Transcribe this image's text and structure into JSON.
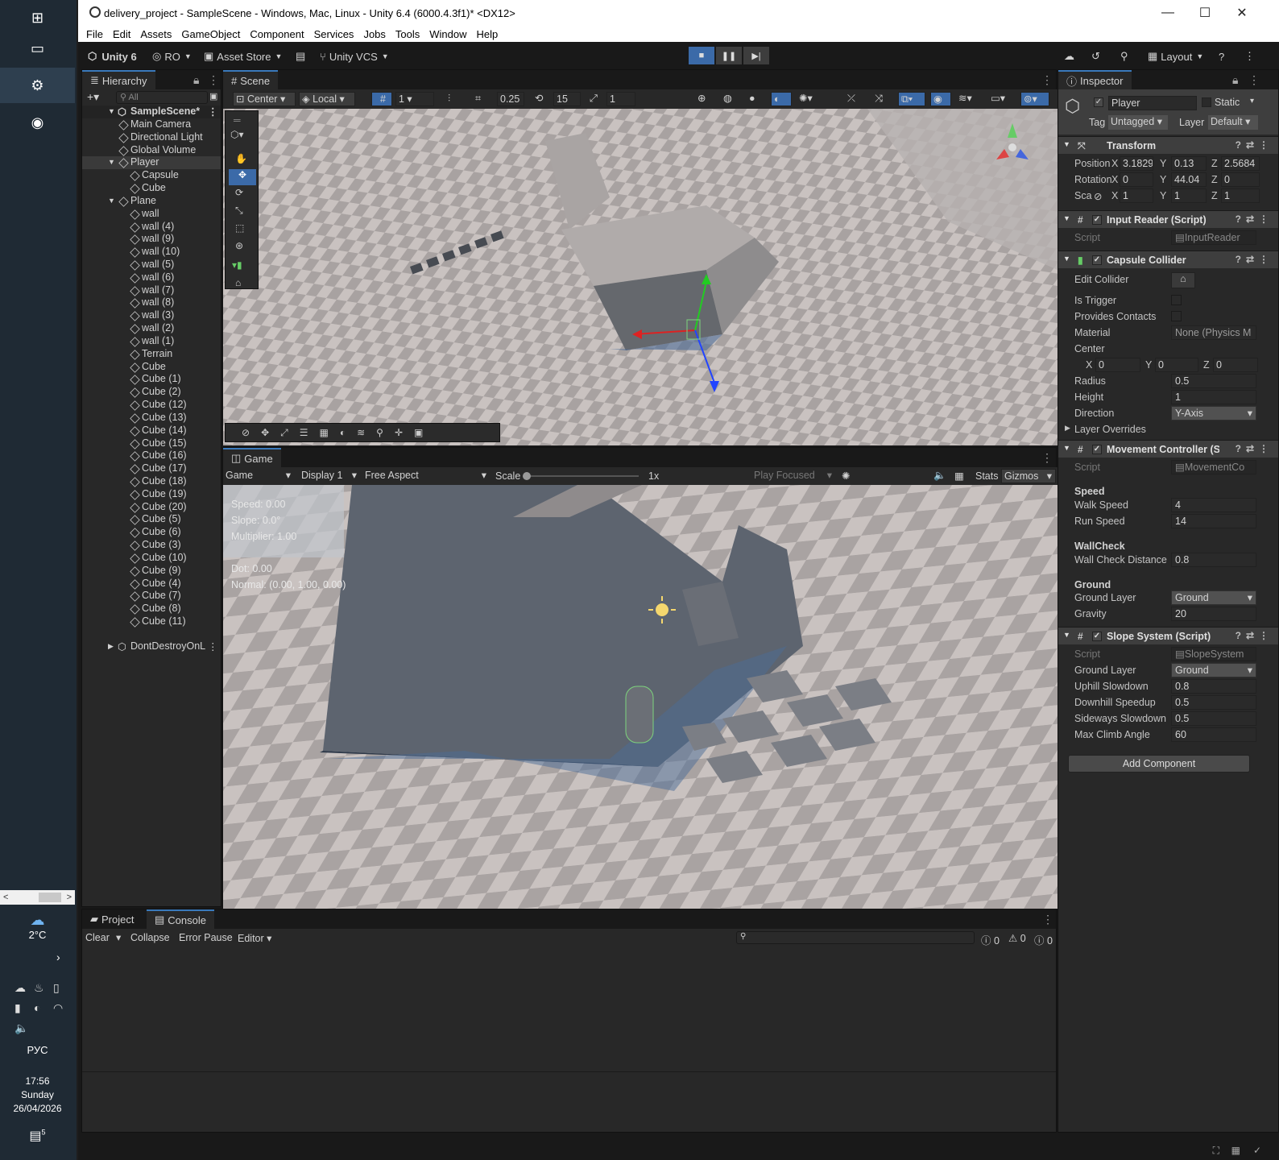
{
  "window": {
    "title": "delivery_project - SampleScene - Windows, Mac, Linux - Unity 6.4 (6000.4.3f1)* <DX12>",
    "controls": [
      "—",
      "☐",
      "✕"
    ]
  },
  "menu": [
    "File",
    "Edit",
    "Assets",
    "GameObject",
    "Component",
    "Services",
    "Jobs",
    "Tools",
    "Window",
    "Help"
  ],
  "toolbar": {
    "unity_label": "Unity 6",
    "account": "RO",
    "asset_store": "Asset Store",
    "vcs": "Unity VCS",
    "layout": "Layout"
  },
  "hierarchy": {
    "tab": "Hierarchy",
    "search_placeholder": "All",
    "scene": "SampleScene*",
    "items": [
      {
        "label": "Main Camera",
        "depth": 1
      },
      {
        "label": "Directional Light",
        "depth": 1
      },
      {
        "label": "Global Volume",
        "depth": 1
      },
      {
        "label": "Player",
        "depth": 1,
        "expand": true,
        "selected": true
      },
      {
        "label": "Capsule",
        "depth": 2
      },
      {
        "label": "Cube",
        "depth": 2
      },
      {
        "label": "Plane",
        "depth": 1,
        "expand": true
      },
      {
        "label": "wall",
        "depth": 2
      },
      {
        "label": "wall (4)",
        "depth": 2
      },
      {
        "label": "wall (9)",
        "depth": 2
      },
      {
        "label": "wall (10)",
        "depth": 2
      },
      {
        "label": "wall (5)",
        "depth": 2
      },
      {
        "label": "wall (6)",
        "depth": 2
      },
      {
        "label": "wall (7)",
        "depth": 2
      },
      {
        "label": "wall (8)",
        "depth": 2
      },
      {
        "label": "wall (3)",
        "depth": 2
      },
      {
        "label": "wall (2)",
        "depth": 2
      },
      {
        "label": "wall (1)",
        "depth": 2
      },
      {
        "label": "Terrain",
        "depth": 2
      },
      {
        "label": "Cube",
        "depth": 2
      },
      {
        "label": "Cube (1)",
        "depth": 2
      },
      {
        "label": "Cube (2)",
        "depth": 2
      },
      {
        "label": "Cube (12)",
        "depth": 2
      },
      {
        "label": "Cube (13)",
        "depth": 2
      },
      {
        "label": "Cube (14)",
        "depth": 2
      },
      {
        "label": "Cube (15)",
        "depth": 2
      },
      {
        "label": "Cube (16)",
        "depth": 2
      },
      {
        "label": "Cube (17)",
        "depth": 2
      },
      {
        "label": "Cube (18)",
        "depth": 2
      },
      {
        "label": "Cube (19)",
        "depth": 2
      },
      {
        "label": "Cube (20)",
        "depth": 2
      },
      {
        "label": "Cube (5)",
        "depth": 2
      },
      {
        "label": "Cube (6)",
        "depth": 2
      },
      {
        "label": "Cube (3)",
        "depth": 2
      },
      {
        "label": "Cube (10)",
        "depth": 2
      },
      {
        "label": "Cube (9)",
        "depth": 2
      },
      {
        "label": "Cube (4)",
        "depth": 2
      },
      {
        "label": "Cube (7)",
        "depth": 2
      },
      {
        "label": "Cube (8)",
        "depth": 2
      },
      {
        "label": "Cube (11)",
        "depth": 2
      }
    ],
    "dont_destroy": "DontDestroyOnL"
  },
  "scene": {
    "tab": "Scene",
    "pivot": "Center",
    "space": "Local",
    "grid": "1",
    "snap": "0.25",
    "rotate_snap": "15",
    "scale_snap": "1"
  },
  "game": {
    "tab": "Game",
    "mode": "Game",
    "display": "Display 1",
    "aspect": "Free Aspect",
    "scale_label": "Scale",
    "scale_value": "1x",
    "play_focused": "Play Focused",
    "stats": "Stats",
    "gizmos": "Gizmos",
    "overlay": {
      "speed": "Speed: 0.00",
      "slope": "Slope: 0.0°",
      "multiplier": "Multiplier: 1.00",
      "dot": "Dot: 0.00",
      "normal": "Normal: (0.00, 1.00, 0.00)"
    }
  },
  "console": {
    "tab_project": "Project",
    "tab_console": "Console",
    "clear": "Clear",
    "collapse": "Collapse",
    "error_pause": "Error Pause",
    "editor": "Editor",
    "counts": [
      "0",
      "0",
      "0"
    ]
  },
  "inspector": {
    "tab": "Inspector",
    "object_name": "Player",
    "static_label": "Static",
    "tag_label": "Tag",
    "tag": "Untagged",
    "layer_label": "Layer",
    "layer": "Default",
    "transform": {
      "title": "Transform",
      "position_label": "Position",
      "rotation_label": "Rotation",
      "scale_label": "Sca",
      "position": [
        "3.18290",
        "0.13",
        "2.5684"
      ],
      "rotation": [
        "0",
        "44.04",
        "0"
      ],
      "scale": [
        "1",
        "1",
        "1"
      ]
    },
    "input_reader": {
      "title": "Input Reader (Script)",
      "script_label": "Script",
      "script": "InputReader"
    },
    "capsule": {
      "title": "Capsule Collider",
      "edit_collider": "Edit Collider",
      "is_trigger": "Is Trigger",
      "provides_contacts": "Provides Contacts",
      "material_label": "Material",
      "material": "None (Physics M",
      "center_label": "Center",
      "center": [
        "0",
        "0",
        "0"
      ],
      "radius_label": "Radius",
      "radius": "0.5",
      "height_label": "Height",
      "height": "1",
      "direction_label": "Direction",
      "direction": "Y-Axis",
      "layer_overrides": "Layer Overrides"
    },
    "movement": {
      "title": "Movement Controller (S",
      "script_label": "Script",
      "script": "MovementCo",
      "speed_header": "Speed",
      "walk_label": "Walk Speed",
      "walk": "4",
      "run_label": "Run Speed",
      "run": "14",
      "wallcheck_header": "WallCheck",
      "wall_label": "Wall Check Distance",
      "wall": "0.8",
      "ground_header": "Ground",
      "ground_layer_label": "Ground Layer",
      "ground_layer": "Ground",
      "gravity_label": "Gravity",
      "gravity": "20"
    },
    "slope": {
      "title": "Slope System (Script)",
      "script_label": "Script",
      "script": "SlopeSystem",
      "ground_layer_label": "Ground Layer",
      "ground_layer": "Ground",
      "uphill_label": "Uphill Slowdown",
      "uphill": "0.8",
      "downhill_label": "Downhill Speedup",
      "downhill": "0.5",
      "sideways_label": "Sideways Slowdown",
      "sideways": "0.5",
      "maxclimb_label": "Max Climb Angle",
      "maxclimb": "60"
    },
    "add_component": "Add Component"
  },
  "taskbar": {
    "temperature": "2°C",
    "language": "РУС",
    "time": "17:56",
    "day": "Sunday",
    "date": "26/04/2026",
    "notifications": "5"
  }
}
